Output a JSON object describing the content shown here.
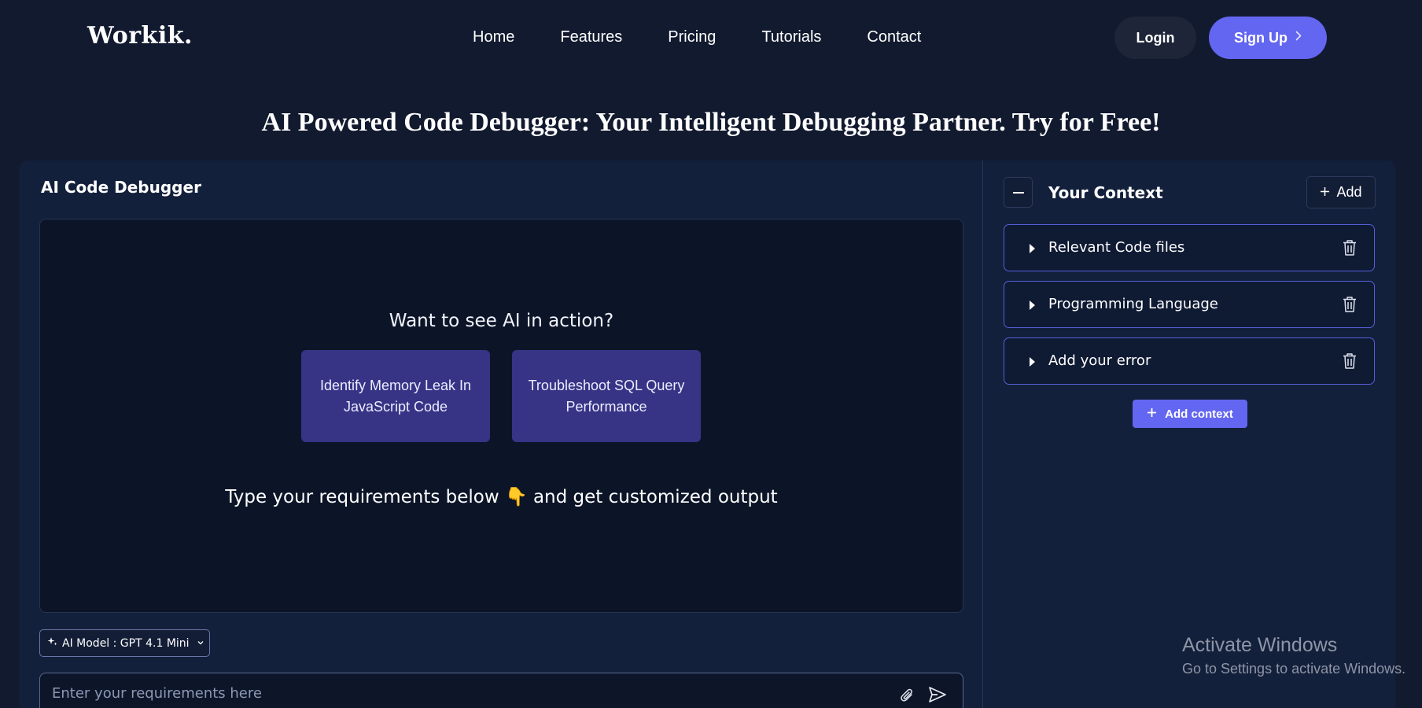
{
  "header": {
    "logo": "Workik.",
    "nav": [
      "Home",
      "Features",
      "Pricing",
      "Tutorials",
      "Contact"
    ],
    "login_label": "Login",
    "signup_label": "Sign Up"
  },
  "headline": "AI Powered Code Debugger: Your Intelligent Debugging Partner. Try for Free!",
  "debugger": {
    "title": "AI Code Debugger",
    "prompt_question": "Want to see AI in action?",
    "samples": [
      "Identify Memory Leak In JavaScript Code",
      "Troubleshoot SQL Query Performance"
    ],
    "type_hint": "Type your requirements below 👇 and get customized output",
    "model_label": "AI Model : GPT 4.1 Mini",
    "input_placeholder": "Enter your requirements here",
    "input_value": ""
  },
  "context": {
    "title": "Your Context",
    "add_label": "Add",
    "items": [
      "Relevant Code files",
      "Programming Language",
      "Add your error"
    ],
    "add_context_label": "Add context"
  },
  "watermark": {
    "line1": "Activate Windows",
    "line2": "Go to Settings to activate Windows."
  },
  "colors": {
    "background": "#121a2f",
    "panel": "#13203b",
    "accent": "#6366f1",
    "sample_card": "#373486"
  },
  "icons": [
    "sparkle-icon",
    "chevron-down-icon",
    "paperclip-icon",
    "send-icon",
    "minus-icon",
    "plus-icon",
    "caret-right-icon",
    "trash-icon",
    "chevron-right-icon"
  ]
}
